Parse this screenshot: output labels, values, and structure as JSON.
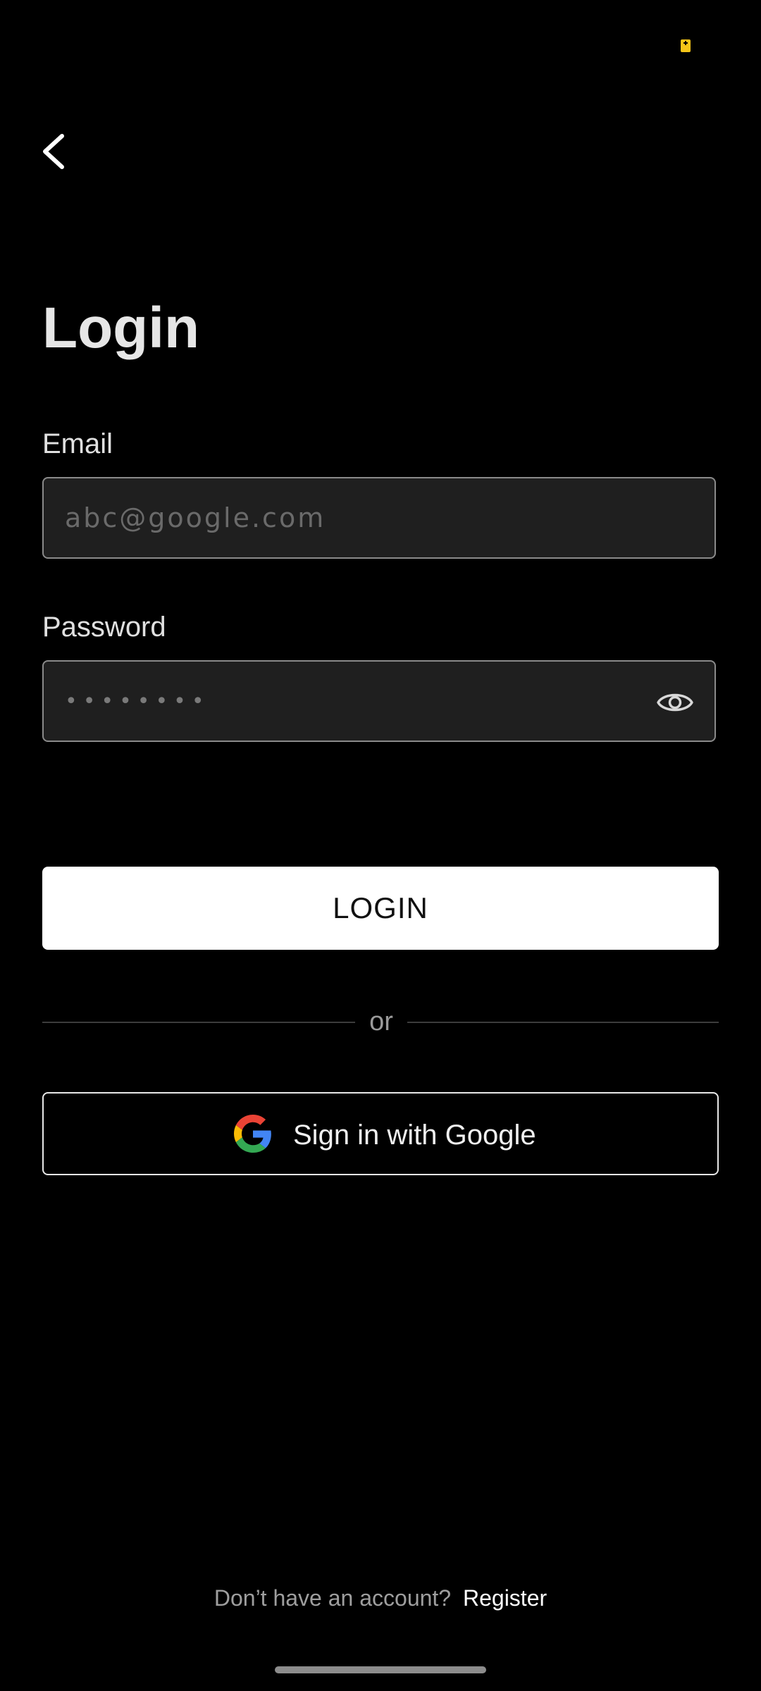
{
  "screen": {
    "title": "Login"
  },
  "status_bar": {
    "battery_icon": "battery-charging-icon",
    "battery_color": "#f5c518"
  },
  "nav": {
    "back_icon": "chevron-left-icon"
  },
  "form": {
    "email": {
      "label": "Email",
      "placeholder": "abc@google.com",
      "value": ""
    },
    "password": {
      "label": "Password",
      "value": "••••••••",
      "toggle_icon": "eye-icon"
    },
    "login_button": "LOGIN"
  },
  "divider": {
    "text": "or"
  },
  "google": {
    "label": "Sign in with Google",
    "icon": "google-icon"
  },
  "footer": {
    "prompt": "Don’t have an account?",
    "register": "Register"
  },
  "colors": {
    "background": "#000000",
    "input_fill": "#1f1f1f",
    "input_border": "#8a8a8a",
    "primary_button": "#ffffff"
  }
}
